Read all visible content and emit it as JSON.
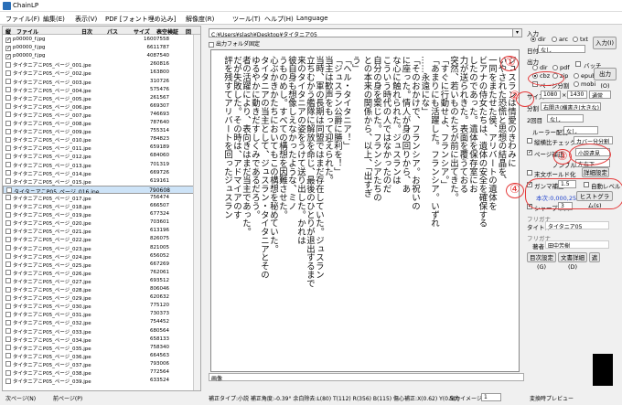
{
  "app": {
    "title": "ChainLP"
  },
  "menu": [
    "ファイル(F)",
    "編集(E)",
    "表示(V)",
    "PDF [フォント埋め込み]",
    "解像度(R)",
    "ツール(T)",
    "ヘルプ(H)",
    "Language"
  ],
  "filelist": {
    "headers": [
      "縦",
      "ファイル",
      "日次",
      "パス",
      "サイズ",
      "表空検証",
      "回"
    ],
    "rows": [
      {
        "name": "p00000_f.jpg",
        "size": "16007558",
        "checked": true
      },
      {
        "name": "p00000_f.jpg",
        "size": "6611787",
        "checked": true
      },
      {
        "name": "p00000_f.jpg",
        "size": "4087540",
        "checked": true
      },
      {
        "name": "タイタニアこP05_ページ_001.jpe",
        "size": "260816",
        "checked": false
      },
      {
        "name": "タイタニアこP05_ページ_002.jpe",
        "size": "163800",
        "checked": false
      },
      {
        "name": "タイタニアこP05_ページ_003.jpe",
        "size": "310726",
        "checked": false
      },
      {
        "name": "タイタニアこP05_ページ_004.jpe",
        "size": "575476",
        "checked": false
      },
      {
        "name": "タイタニアこP05_ページ_005.jpe",
        "size": "261567",
        "checked": false
      },
      {
        "name": "タイタニアこP05_ページ_006.jpe",
        "size": "669307",
        "checked": false
      },
      {
        "name": "タイタニアこP05_ページ_007.jpe",
        "size": "746693",
        "checked": false
      },
      {
        "name": "タイタニアこP05_ページ_008.jpe",
        "size": "787640",
        "checked": false
      },
      {
        "name": "タイタニアこP05_ページ_009.jpe",
        "size": "755314",
        "checked": false
      },
      {
        "name": "タイタニアこP05_ページ_010.jpe",
        "size": "784823",
        "checked": false
      },
      {
        "name": "タイタニアこP05_ページ_011.jpe",
        "size": "659189",
        "checked": false
      },
      {
        "name": "タイタニアこP05_ページ_012.jpe",
        "size": "684060",
        "checked": false
      },
      {
        "name": "タイタニアこP05_ページ_013.jpe",
        "size": "701319",
        "checked": false
      },
      {
        "name": "タイタニアこP05_ページ_014.jpe",
        "size": "669726",
        "checked": false
      },
      {
        "name": "タイタニアこP05_ページ_015.jpe",
        "size": "619161",
        "checked": false
      },
      {
        "name": "タイタニアこP05_ページ_016.jpe",
        "size": "790608",
        "checked": false,
        "selected": true
      },
      {
        "name": "タイタニアこP05_ページ_017.jpe",
        "size": "756474",
        "checked": false
      },
      {
        "name": "タイタニアこP05_ページ_018.jpe",
        "size": "666507",
        "checked": false
      },
      {
        "name": "タイタニアこP05_ページ_019.jpe",
        "size": "677324",
        "checked": false
      },
      {
        "name": "タイタニアこP05_ページ_020.jpe",
        "size": "703601",
        "checked": false
      },
      {
        "name": "タイタニアこP05_ページ_021.jpe",
        "size": "613196",
        "checked": false
      },
      {
        "name": "タイタニアこP05_ページ_022.jpe",
        "size": "826075",
        "checked": false
      },
      {
        "name": "タイタニアこP05_ページ_023.jpe",
        "size": "821005",
        "checked": false
      },
      {
        "name": "タイタニアこP05_ページ_024.jpe",
        "size": "656052",
        "checked": false
      },
      {
        "name": "タイタニアこP05_ページ_025.jpe",
        "size": "667269",
        "checked": false
      },
      {
        "name": "タイタニアこP05_ページ_026.jpe",
        "size": "762061",
        "checked": false
      },
      {
        "name": "タイタニアこP05_ページ_027.jpe",
        "size": "693512",
        "checked": false
      },
      {
        "name": "タイタニアこP05_ページ_028.jpe",
        "size": "806046",
        "checked": false
      },
      {
        "name": "タイタニアこP05_ページ_029.jpe",
        "size": "620632",
        "checked": false
      },
      {
        "name": "タイタニアこP05_ページ_030.jpe",
        "size": "775120",
        "checked": false
      },
      {
        "name": "タイタニアこP05_ページ_031.jpe",
        "size": "730373",
        "checked": false
      },
      {
        "name": "タイタニアこP05_ページ_032.jpe",
        "size": "754452",
        "checked": false
      },
      {
        "name": "タイタニアこP05_ページ_033.jpe",
        "size": "680564",
        "checked": false
      },
      {
        "name": "タイタニアこP05_ページ_034.jpe",
        "size": "658133",
        "checked": false
      },
      {
        "name": "タイタニアこP05_ページ_035.jpe",
        "size": "758340",
        "checked": false
      },
      {
        "name": "タイタニアこP05_ページ_036.jpe",
        "size": "664563",
        "checked": false
      },
      {
        "name": "タイタニアこP05_ページ_037.jpe",
        "size": "793006",
        "checked": false
      },
      {
        "name": "タイタニアこP05_ページ_038.jpe",
        "size": "772564",
        "checked": false
      },
      {
        "name": "タイタニアこP05_ページ_039.jpe",
        "size": "633524",
        "checked": false
      }
    ]
  },
  "viewer": {
    "path": "C:¥Users¥slash¥Desktop¥タイタニア05",
    "fixed_label": "出力フォルダ固定",
    "columns": [
      "う」",
      "「ヘル・タイタニア！」",
      "「ジュスラン公爵に勝利を！」",
      "当主は歓声をもって迎えられた。",
      "当時、軍の長期は同盟ではまだ存在していた。ジュスラン",
      "立ちむかう艦隊に解放を命じ、最後のひとりが退出するまで",
      "来のタイタニアの姿をうけて送り出した。かれは",
      "彼自身も想像しえなかったような、ミノ",
      "うものめし。すべての構想を因難させた。",
      "心ぶかきかたちにおいてもこの構想を秘めていた。",
      "タイタニアの当主として、ジュスラン・タイタニアとその",
      "ゆるやかに動きだすしくみであるだろう。",
      "者の活躍により、表向きはまだ当主であった。",
      "だが失敗した。その時は、アドマイアのす",
      "評を残すてアリバートを回ったジュスラン"
    ],
    "columns_right": [
      "ジュスランは情愛のきわみに",
      "いやされた恐慌と思想の結晶を、",
      "一同をまたせた侯、アリバートの遺体を",
      "ビアナの侍女たちは、遺体の安全を確保する",
      "したのであった。遺体を保存室にお",
      "力が送られきた。表面を覆うておる",
      "突然、若いものたちが前に出てきた。",
      "「すぐに行動せよ、フランシア。」",
      "「あまりにも活躍した。フランシア。いずれ",
      "……永遠にな」",
      "「そのおかけで、フランシア。お祝いの",
      "に座った。情人が身の回りから、あ",
      "な心に触れられた。ジュスランは",
      "こういう時代の人ではなかったのだ",
      "自分の身を案じた。フランシアたちの",
      "との本来の関係から、以上、「出すぎ"
    ],
    "preview_label": "画像"
  },
  "status": {
    "prev": "次ページ(N)",
    "next": "前ページ(P)",
    "info": "補正タイプ:小説 補正角度:-0.39° 余白除去:L(80) T(112) R(356) B(115) 傷心補正:X(0.62) Y(0.50)",
    "output_image": "出力イメージ",
    "output_image_value": "1",
    "preview_check": "変換時プレビュー"
  },
  "right": {
    "input": "入力",
    "input_opts": [
      "dir",
      "arc",
      "txt"
    ],
    "input_btn": "入力(I)",
    "folder": "日付",
    "folder_value": "なし",
    "output": "出力",
    "output_opts": [
      "dir",
      "pdf",
      "cbz",
      "zip",
      "ページ分割",
      "epub",
      "mobi"
    ],
    "batch": "バッチ",
    "output_btn": "出力(O)",
    "size_label": "サイズ",
    "size_w": "1080",
    "size_h": "1430",
    "size_mode": "通常",
    "split_label": "分割",
    "split_value": "右開き(横書き(大きな)",
    "split2_label": "2回目",
    "split2_value": "なし",
    "rule_label": "ルーラー配置",
    "rule_value": "なし",
    "vert_label": "縦横比チェック",
    "vert_value": "カバー分分割",
    "page_corr": "ページ補正",
    "page_corr_value": "小説遠見",
    "noble": "ノンブル",
    "noble_value": "左右下",
    "margin": "末文ボールド化",
    "detail_btn": "詳細設定",
    "gamma": "ガンマ補正",
    "gamma_value": "1.5",
    "auto_level": "自動レベル",
    "color_info": "本次:0,000,255",
    "histogram_btn": "ヒストグラム(s)",
    "sharpness": "シャープネス",
    "sharpness_value": "3",
    "author_kana": "フリガナ",
    "title_label": "タイトル",
    "title_value": "タイタニア05",
    "author_kana2": "フリガナ",
    "author_label": "著者",
    "author_value": "田中芳樹",
    "toc_btn": "目次設定(G)",
    "doc_btn": "文書詳細(D)",
    "close_btn": "遮"
  },
  "annotations": [
    "①",
    "②",
    "③",
    "④"
  ],
  "colors": {
    "accent": "#e53b3b",
    "selection": "#cde3f7"
  }
}
